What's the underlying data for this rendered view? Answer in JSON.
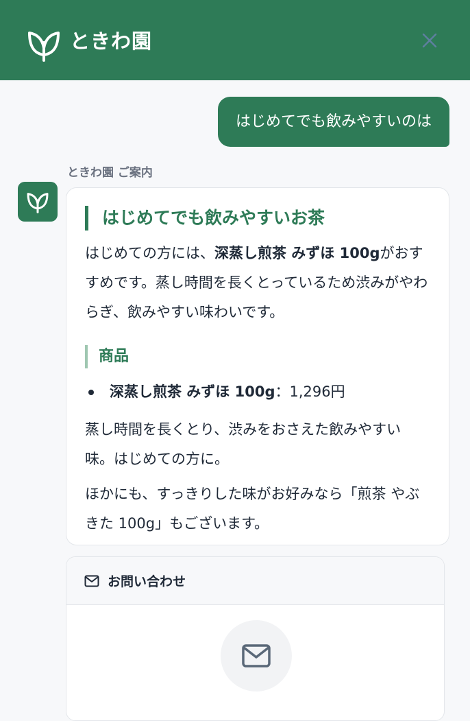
{
  "header": {
    "brand": "ときわ園",
    "logo_icon": "leaf-icon",
    "close_icon": "close-icon",
    "color": "#2e7b57"
  },
  "user_message": "はじめてでも飲みやすいのは",
  "bot": {
    "sender_label": "ときわ園 ご案内",
    "avatar_icon": "leaf-icon",
    "title": "はじめてでも飲みやすいお茶",
    "intro_prefix": "はじめての方には、",
    "intro_product": "深蒸し煎茶 みずほ 100g",
    "intro_suffix": "がおすすめです。蒸し時間を長くとっているため渋みがやわらぎ、飲みやすい味わいです。",
    "section_title": "商品",
    "products": [
      {
        "name": "深蒸し煎茶 みずほ 100g",
        "separator": "：",
        "price": "1,296円"
      }
    ],
    "description": "蒸し時間を長くとり、渋みをおさえた飲みやすい味。はじめての方に。",
    "alternative": "ほかにも、すっきりした味がお好みなら「煎茶 やぶきた 100g」もございます。"
  },
  "contact": {
    "title": "お問い合わせ",
    "header_icon": "mail-icon",
    "body_icon": "mail-icon"
  }
}
